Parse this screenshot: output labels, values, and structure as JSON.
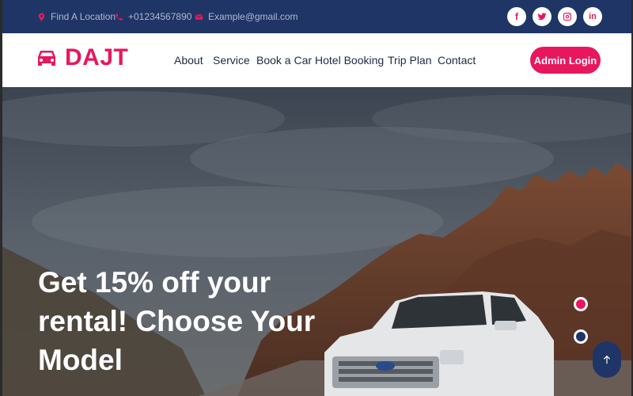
{
  "topbar": {
    "location": "Find A Location",
    "phone": "+01234567890",
    "email": "Example@gmail.com",
    "social": [
      {
        "icon": "facebook-icon",
        "label": "f"
      },
      {
        "icon": "twitter-icon",
        "label": ""
      },
      {
        "icon": "instagram-icon",
        "label": ""
      },
      {
        "icon": "linkedin-icon",
        "label": "in"
      }
    ]
  },
  "brand": {
    "name": "DAJT",
    "icon": "car-icon"
  },
  "nav": {
    "about": "About",
    "service": "Service",
    "book_car": "Book a Car",
    "hotel_booking": "Hotel Booking",
    "trip_plan": "Trip Plan",
    "contact": "Contact",
    "admin_login": "Admin Login"
  },
  "hero": {
    "title": "Get 15% off your rental! Choose Your Model",
    "carousel_active_index": 0,
    "carousel_count": 2
  },
  "colors": {
    "accent": "#e8175d",
    "navy": "#1f3566"
  }
}
